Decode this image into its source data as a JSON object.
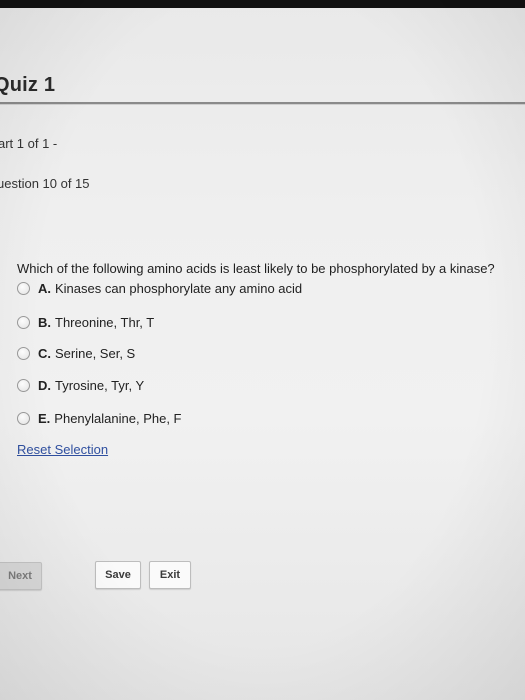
{
  "header": {
    "title": "Quiz 1",
    "part": "art 1 of 1 -",
    "question_counter": "uestion 10 of 15"
  },
  "question": {
    "text": "Which of the following amino acids is least likely to be phosphorylated by a kinase?",
    "choices": [
      {
        "letter": "A.",
        "text": "Kinases can phosphorylate any amino acid",
        "selected": false
      },
      {
        "letter": "B.",
        "text": "Threonine, Thr, T",
        "selected": false
      },
      {
        "letter": "C.",
        "text": "Serine, Ser, S",
        "selected": false
      },
      {
        "letter": "D.",
        "text": "Tyrosine, Tyr, Y",
        "selected": false
      },
      {
        "letter": "E.",
        "text": "Phenylalanine, Phe, F",
        "selected": false
      }
    ],
    "reset_label": "Reset Selection"
  },
  "footer": {
    "next_label": "Next",
    "save_label": "Save",
    "exit_label": "Exit"
  },
  "colors": {
    "link": "#2f4f9f",
    "background": "#eeeeee"
  }
}
